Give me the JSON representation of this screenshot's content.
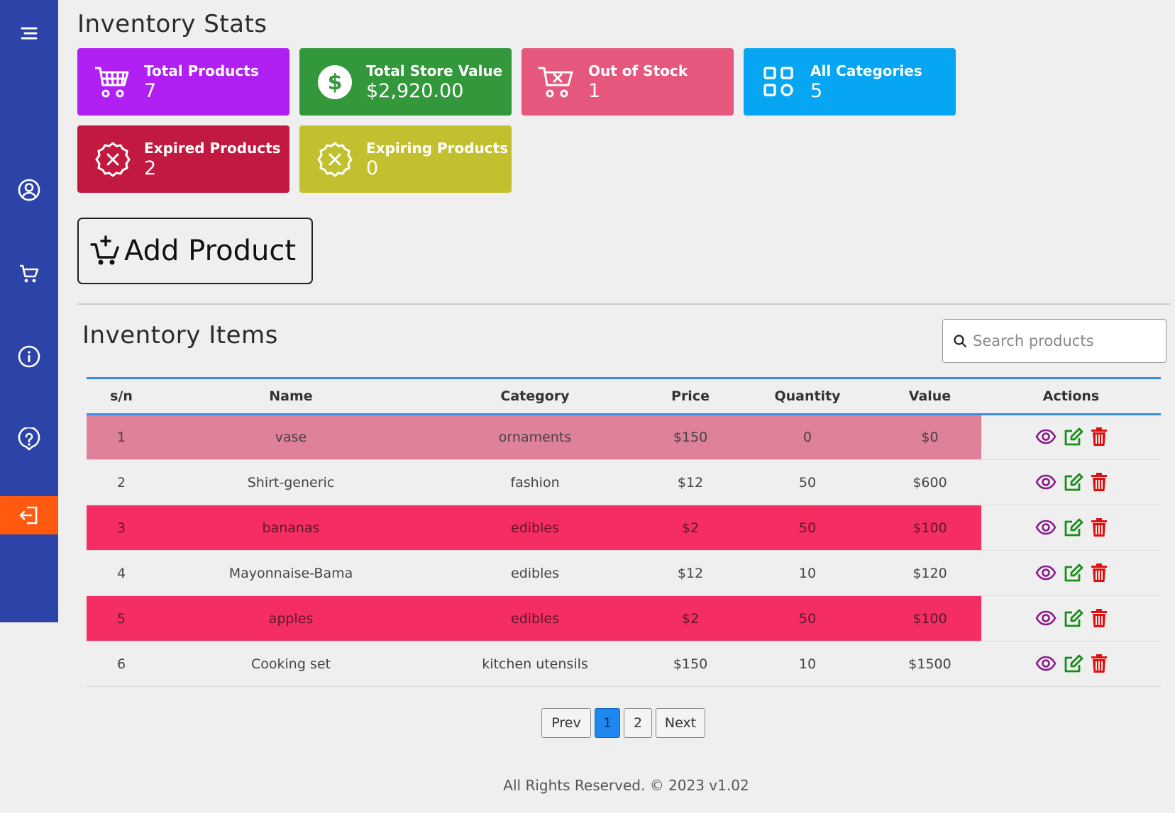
{
  "stats": {
    "heading": "Inventory Stats",
    "cards": [
      {
        "label": "Total Products",
        "value": "7",
        "color": "#b120f2",
        "icon": "shopping-basket-icon"
      },
      {
        "label": "Total Store Value",
        "value": "$2,920.00",
        "color": "#33973c",
        "icon": "dollar-circle-icon"
      },
      {
        "label": "Out of Stock",
        "value": "1",
        "color": "#e5577c",
        "icon": "cart-x-icon"
      },
      {
        "label": "All Categories",
        "value": "5",
        "color": "#06a6f2",
        "icon": "categories-grid-icon"
      },
      {
        "label": "Expired Products",
        "value": "2",
        "color": "#c1193f",
        "icon": "x-badge-icon"
      },
      {
        "label": "Expiring Products",
        "value": "0",
        "color": "#c2c02e",
        "icon": "x-badge-icon"
      }
    ]
  },
  "add_button": {
    "label": "Add Product"
  },
  "items": {
    "heading": "Inventory Items",
    "search_placeholder": "Search products",
    "columns": [
      "s/n",
      "Name",
      "Category",
      "Price",
      "Quantity",
      "Value",
      "Actions"
    ],
    "rows": [
      {
        "sn": "1",
        "name": "vase",
        "category": "ornaments",
        "price": "$150",
        "quantity": "0",
        "value": "$0",
        "status": "out-of-stock"
      },
      {
        "sn": "2",
        "name": "Shirt-generic",
        "category": "fashion",
        "price": "$12",
        "quantity": "50",
        "value": "$600",
        "status": "normal"
      },
      {
        "sn": "3",
        "name": "bananas",
        "category": "edibles",
        "price": "$2",
        "quantity": "50",
        "value": "$100",
        "status": "expired"
      },
      {
        "sn": "4",
        "name": "Mayonnaise-Bama",
        "category": "edibles",
        "price": "$12",
        "quantity": "10",
        "value": "$120",
        "status": "normal"
      },
      {
        "sn": "5",
        "name": "apples",
        "category": "edibles",
        "price": "$2",
        "quantity": "50",
        "value": "$100",
        "status": "expired"
      },
      {
        "sn": "6",
        "name": "Cooking set",
        "category": "kitchen utensils",
        "price": "$150",
        "quantity": "10",
        "value": "$1500",
        "status": "normal"
      }
    ]
  },
  "pagination": {
    "prev": "Prev",
    "pages": [
      "1",
      "2"
    ],
    "current": "1",
    "next": "Next"
  },
  "footer": "All Rights Reserved. © 2023 v1.02",
  "colors": {
    "sidebar": "#2c44a8",
    "logout": "#ff5a10",
    "out_of_stock_row": "#de8199",
    "expired_row": "#f42e62",
    "view_icon": "#8b1a8b",
    "edit_icon": "#1a8c1a",
    "delete_icon": "#e01010"
  }
}
